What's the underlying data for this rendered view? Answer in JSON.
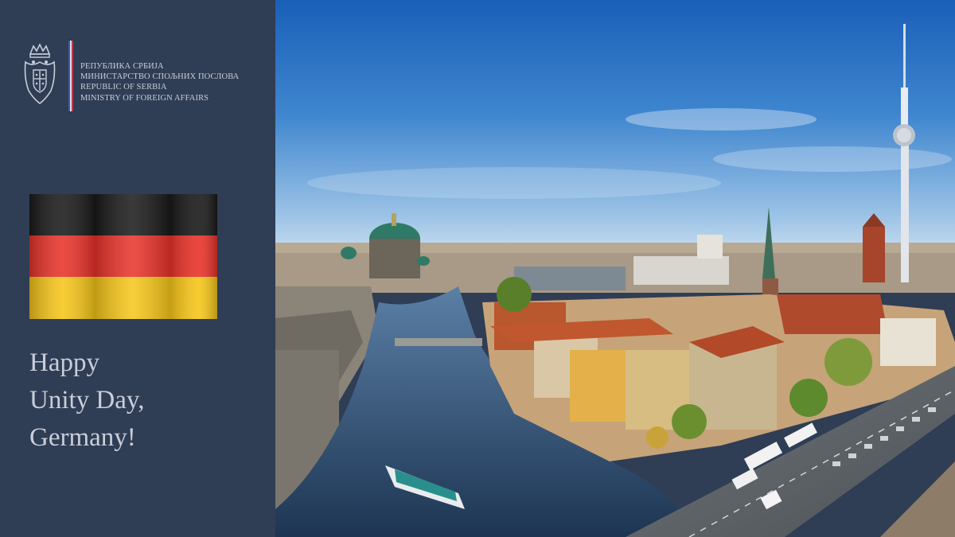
{
  "header": {
    "ministry_lines": [
      "РЕПУБЛИКА СРБИЈА",
      "МИНИСТАРСТВО СПОЉНИХ ПОСЛОВА",
      "REPUBLIC OF SERBIA",
      "MINISTRY OF FOREIGN AFFAIRS"
    ],
    "emblem_icon": "serbian-coat-of-arms-icon"
  },
  "flag": {
    "icon": "germany-flag-icon",
    "colors": [
      "#1a1a1a",
      "#e8332a",
      "#f6c61a"
    ]
  },
  "greeting": {
    "lines": [
      "Happy",
      "Unity Day,",
      "Germany!"
    ]
  },
  "photo": {
    "icon": "berlin-cityscape-photo"
  },
  "colors": {
    "panel": "#2f3d55",
    "text": "#c9ced8",
    "divider": [
      "#3b5ea8",
      "#d7dbe4",
      "#c2364a"
    ]
  }
}
